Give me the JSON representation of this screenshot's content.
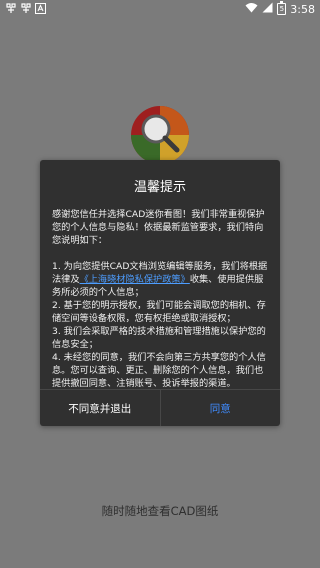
{
  "status_bar": {
    "left_icons": [
      "notification-icon-1",
      "notification-icon-2",
      "notification-icon-3"
    ],
    "battery_level": "5",
    "time": "3:58"
  },
  "dialog": {
    "title": "温馨提示",
    "intro": "感谢您信任并选择CAD迷你看图！我们非常重视保护您的个人信息与隐私！依据最新监管要求，我们特向您说明如下：",
    "item1_prefix": "1. 为向您提供CAD文档浏览编辑等服务，我们将根据法律及",
    "item1_link": "《上海晓材隐私保护政策》",
    "item1_suffix": "收集、使用提供服务所必须的个人信息；",
    "item2": "2. 基于您的明示授权，我们可能会调取您的相机、存储空间等设备权限，您有权拒绝或取消授权；",
    "item3": "3. 我们会采取严格的技术措施和管理措施以保护您的信息安全；",
    "item4": "4. 未经您的同意，我们不会向第三方共享您的个人信息。您可以查询、更正、删除您的个人信息，我们也提供撤回同意、注销账号、投诉举报的渠道。",
    "disagree_label": "不同意并退出",
    "agree_label": "同意"
  },
  "tagline": "随时随地查看CAD图纸",
  "colors": {
    "overlay": "#7b7b7b",
    "dialog_bg": "#303030",
    "link": "#4d9dff",
    "agree": "#3f8cff"
  }
}
